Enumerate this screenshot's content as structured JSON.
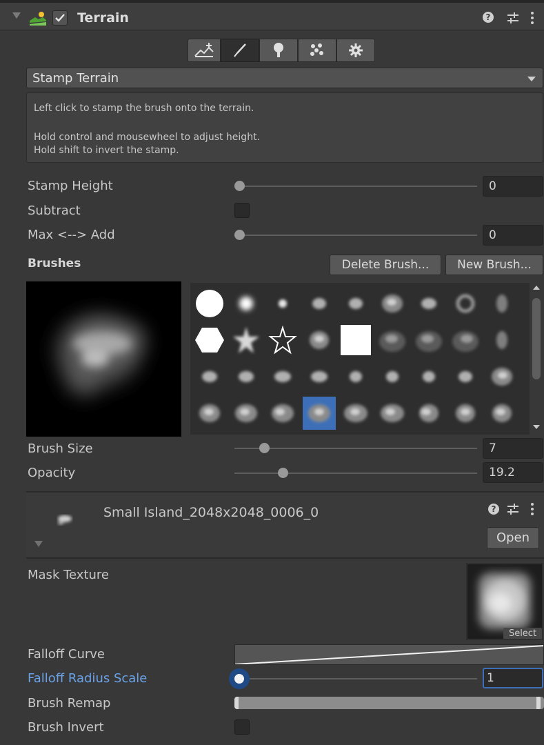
{
  "header": {
    "title": "Terrain",
    "enabled": true,
    "icons": [
      "help-icon",
      "presets-icon",
      "kebab-menu-icon"
    ]
  },
  "toolbar": {
    "tools": [
      "raise-lower-terrain-icon",
      "paint-brush-icon",
      "paint-trees-icon",
      "paint-details-icon",
      "terrain-settings-icon"
    ],
    "selected_index": 1
  },
  "tool_select": {
    "value": "Stamp Terrain"
  },
  "help": {
    "line1": "Left click to stamp the brush onto the terrain.",
    "line2": "Hold control and mousewheel to adjust height.",
    "line3": "Hold shift to invert the stamp."
  },
  "stamp": {
    "height_label": "Stamp Height",
    "height_value": "0",
    "height_fraction": 0,
    "subtract_label": "Subtract",
    "subtract_checked": false,
    "maxadd_label": "Max <--> Add",
    "maxadd_value": "0",
    "maxadd_fraction": 0
  },
  "brushes": {
    "heading": "Brushes",
    "delete_label": "Delete Brush...",
    "new_label": "New Brush...",
    "selected_index": 30
  },
  "brush_size": {
    "label": "Brush Size",
    "value": "7",
    "fraction": 0.12
  },
  "opacity": {
    "label": "Opacity",
    "value": "19.2",
    "fraction": 0.192
  },
  "asset": {
    "name": "Small Island_2048x2048_0006_0",
    "open_label": "Open"
  },
  "mask": {
    "label": "Mask Texture",
    "select_label": "Select"
  },
  "falloff_curve": {
    "label": "Falloff Curve"
  },
  "falloff_radius": {
    "label": "Falloff Radius Scale",
    "value": "1",
    "fraction": 0
  },
  "remap": {
    "label": "Brush Remap",
    "min": 0,
    "max": 1
  },
  "invert": {
    "label": "Brush Invert",
    "checked": false
  },
  "colors": {
    "panel_bg": "#383838",
    "field_bg": "#2a2a2a",
    "accent_blue": "#3d6fb8",
    "focused_label": "#6aa2e8"
  }
}
